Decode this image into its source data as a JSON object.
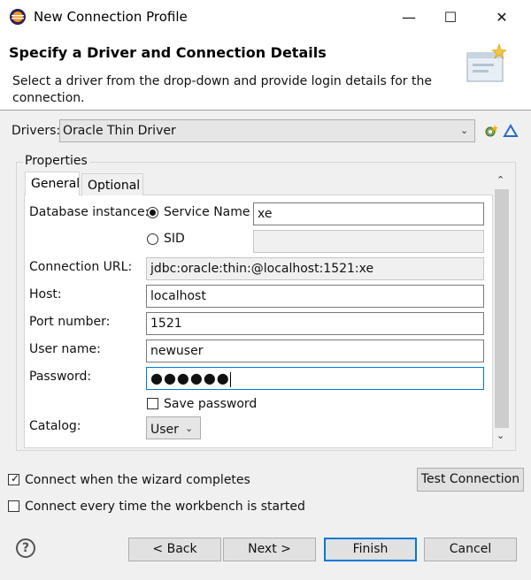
{
  "window": {
    "title": "New Connection Profile",
    "minimize_glyph": "—",
    "maximize_glyph": "☐",
    "close_glyph": "✕"
  },
  "header": {
    "title": "Specify a Driver and Connection Details",
    "description": "Select a driver from the drop-down and provide login details for the connection."
  },
  "drivers": {
    "label": "Drivers:",
    "selected": "Oracle Thin Driver"
  },
  "properties": {
    "group_label": "Properties",
    "tabs": [
      {
        "label": "General",
        "active": true
      },
      {
        "label": "Optional",
        "active": false
      }
    ],
    "database_instance_label": "Database instance:",
    "service_name_label": "Service Name",
    "service_name_value": "xe",
    "sid_label": "SID",
    "sid_value": "",
    "connection_url_label": "Connection URL:",
    "connection_url_value": "jdbc:oracle:thin:@localhost:1521:xe",
    "host_label": "Host:",
    "host_value": "localhost",
    "port_label": "Port number:",
    "port_value": "1521",
    "username_label": "User name:",
    "username_value": "newuser",
    "password_label": "Password:",
    "password_value": "●●●●●●",
    "save_password_label": "Save password",
    "catalog_label": "Catalog:",
    "catalog_value": "User"
  },
  "options": {
    "connect_when_complete": "Connect when the wizard completes",
    "connect_when_complete_checked": true,
    "connect_every_time": "Connect every time the workbench is started",
    "connect_every_time_checked": false
  },
  "buttons": {
    "test_connection": "Test Connection",
    "back": "< Back",
    "next": "Next >",
    "finish": "Finish",
    "cancel": "Cancel",
    "help": "?"
  },
  "colors": {
    "accent": "#0078d7",
    "dialog_bg": "#f0f0f0"
  }
}
